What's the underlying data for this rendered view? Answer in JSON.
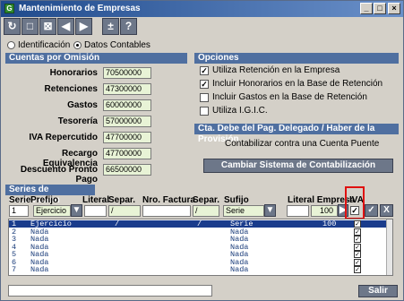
{
  "window": {
    "title": "Mantenimiento de Empresas",
    "app_icon": "G"
  },
  "titlebar_buttons": [
    "_",
    "□",
    "×"
  ],
  "toolbar": {
    "buttons": [
      {
        "name": "refresh-icon",
        "glyph": "↻"
      },
      {
        "name": "new-icon",
        "glyph": "□"
      },
      {
        "name": "delete-icon",
        "glyph": "⊠"
      },
      {
        "name": "prev-icon",
        "glyph": "◀"
      },
      {
        "name": "next-icon",
        "glyph": "▶"
      },
      {
        "name": "plus-minus-icon",
        "glyph": "±"
      },
      {
        "name": "help-icon",
        "glyph": "?"
      }
    ]
  },
  "tabs": {
    "identificacion": "Identificación",
    "datos_contables": "Datos Contables"
  },
  "cuentas": {
    "header": "Cuentas por Omisión",
    "fields": [
      {
        "label": "Honorarios",
        "value": "70500000"
      },
      {
        "label": "Retenciones",
        "value": "47300000"
      },
      {
        "label": "Gastos",
        "value": "60000000"
      },
      {
        "label": "Tesorería",
        "value": "57000000"
      },
      {
        "label": "IVA Repercutido",
        "value": "47700000"
      },
      {
        "label": "Recargo Equivalencia",
        "value": "47700000"
      },
      {
        "label": "Descuento Pronto Pago",
        "value": "66500000"
      }
    ]
  },
  "opciones": {
    "header": "Opciones",
    "items": [
      {
        "label": "Utiliza Retención en la Empresa",
        "checked": true
      },
      {
        "label": "Incluir Honorarios en la Base de Retención",
        "checked": true
      },
      {
        "label": "Incluir Gastos en la Base de Retención",
        "checked": false
      },
      {
        "label": "Utiliza I.G.I.C.",
        "checked": false
      }
    ],
    "check_glyph": "✓"
  },
  "provision": {
    "header": "Cta. Debe del Pag. Delegado / Haber de la Provisión",
    "text": "Contabilizar contra una Cuenta Puente",
    "button": "Cambiar Sistema de Contabilización"
  },
  "series": {
    "header": "Series de Facturación",
    "columns": {
      "serie": "Serie",
      "prefijo": "Prefijo",
      "literal": "Literal",
      "separ": "Separ.",
      "nro_factura": "Nro. Factura",
      "separ2": "Separ.",
      "sufijo": "Sufijo",
      "literal_empresa": "Literal Empresa",
      "iva": "IVA"
    },
    "editor": {
      "serie": "1",
      "prefijo": "Ejercicio",
      "separ": "/",
      "separ2": "/",
      "sufijo": "Serie",
      "literal_empresa": "100"
    },
    "buttons": {
      "next": "▶",
      "accept": "✓",
      "cancel": "X",
      "dropdown": "▼"
    },
    "rows": [
      {
        "num": "1",
        "prefijo": "Ejercicio",
        "sep1": "/",
        "sep2": "/",
        "sufijo": "Serie",
        "empresa": "100",
        "iva": true
      },
      {
        "num": "2",
        "prefijo": "Nada",
        "sep1": "",
        "sep2": "",
        "sufijo": "Nada",
        "empresa": "",
        "iva": true
      },
      {
        "num": "3",
        "prefijo": "Nada",
        "sep1": "",
        "sep2": "",
        "sufijo": "Nada",
        "empresa": "",
        "iva": true
      },
      {
        "num": "4",
        "prefijo": "Nada",
        "sep1": "",
        "sep2": "",
        "sufijo": "Nada",
        "empresa": "",
        "iva": true
      },
      {
        "num": "5",
        "prefijo": "Nada",
        "sep1": "",
        "sep2": "",
        "sufijo": "Nada",
        "empresa": "",
        "iva": true
      },
      {
        "num": "6",
        "prefijo": "Nada",
        "sep1": "",
        "sep2": "",
        "sufijo": "Nada",
        "empresa": "",
        "iva": true
      },
      {
        "num": "7",
        "prefijo": "Nada",
        "sep1": "",
        "sep2": "",
        "sufijo": "Nada",
        "empresa": "",
        "iva": true
      }
    ]
  },
  "footer": {
    "salir": "Salir"
  },
  "colors": {
    "section_header": "#4f6fa0",
    "field_bg": "#e8f3d6",
    "highlight": "#e01010",
    "selection": "#1a3c8c"
  }
}
